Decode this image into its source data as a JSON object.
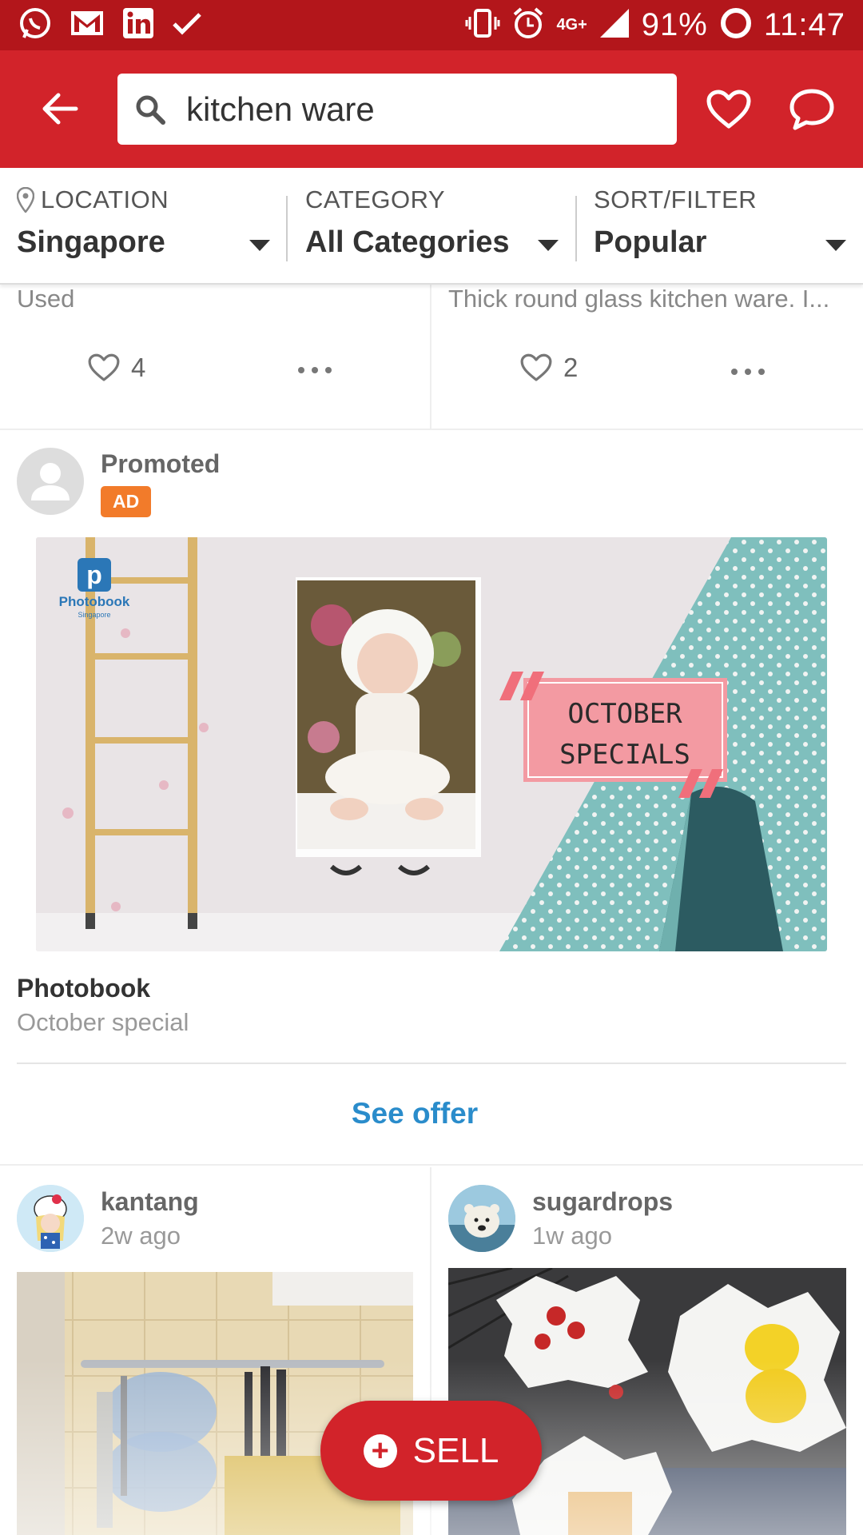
{
  "status_bar": {
    "battery": "91%",
    "time": "11:47",
    "network": "4G+",
    "icons": [
      "whatsapp-icon",
      "gmail-icon",
      "linkedin-icon",
      "check-icon",
      "vibrate-icon",
      "alarm-icon",
      "signal-icon",
      "battery-icon"
    ]
  },
  "header": {
    "search_value": "kitchen ware",
    "icons": [
      "back-arrow-icon",
      "search-icon",
      "heart-icon",
      "chat-icon"
    ]
  },
  "filters": {
    "location": {
      "label": "LOCATION",
      "value": "Singapore"
    },
    "category": {
      "label": "CATEGORY",
      "value": "All Categories"
    },
    "sort": {
      "label": "SORT/FILTER",
      "value": "Popular"
    }
  },
  "top_listings": [
    {
      "snippet": "Used",
      "likes": "4"
    },
    {
      "snippet": "Thick round glass kitchen ware. I...",
      "likes": "2"
    }
  ],
  "promoted": {
    "title": "Promoted",
    "badge": "AD",
    "banner": {
      "logo_text": "Photobook",
      "logo_sub": "Singapore",
      "overlay_line1": "OCTOBER",
      "overlay_line2": "SPECIALS"
    },
    "name": "Photobook",
    "description": "October special",
    "cta": "See offer"
  },
  "bottom_listings": [
    {
      "seller": "kantang",
      "time": "2w ago"
    },
    {
      "seller": "sugardrops",
      "time": "1w ago"
    }
  ],
  "fab": {
    "label": "SELL"
  },
  "colors": {
    "brand_red": "#d2232a",
    "status_red": "#b3161b",
    "link_blue": "#2a8ccb",
    "ad_orange": "#f27b2a"
  }
}
